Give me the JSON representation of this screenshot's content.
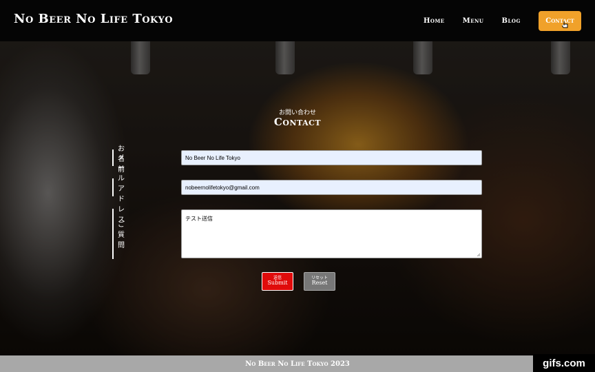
{
  "header": {
    "logo": "No Beer No Life Tokyo",
    "nav": [
      {
        "label": "Home"
      },
      {
        "label": "Menu"
      },
      {
        "label": "Blog"
      },
      {
        "label": "Contact"
      }
    ]
  },
  "section": {
    "subtitle": "お問い合わせ",
    "title": "Contact"
  },
  "form": {
    "name_label": "お名前",
    "name_value": "No Beer No Life Tokyo",
    "email_label": "メールアドレス",
    "email_value": "nobeernolifetokyo@gmail.com",
    "question_label": "ご質問",
    "question_value": "テスト送信",
    "submit_small": "送信",
    "submit_label": "Submit",
    "reset_small": "リセット",
    "reset_label": "Reset"
  },
  "footer": {
    "text": "No Beer No Life Tokyo 2023"
  },
  "watermark": "gifs.com",
  "colors": {
    "accent": "#f0a12a",
    "submit": "#e00b0b",
    "reset": "#777777",
    "footer_bg": "#a8a8a8",
    "input_bg": "#e8f0fe"
  }
}
